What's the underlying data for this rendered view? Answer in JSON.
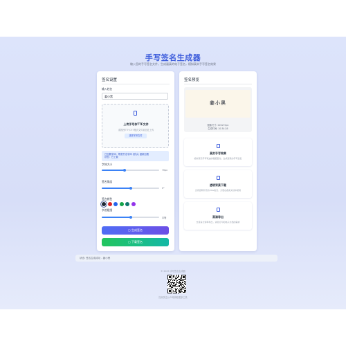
{
  "header": {
    "title": "手写签名生成器",
    "subtitle": "输入您的手写签名文件，生成逼真的电子签名，模拟真实手写签名效果"
  },
  "left_panel": {
    "title": "签名设置",
    "name_label": "输入姓名",
    "name_value": "姜小黑",
    "upload": {
      "title": "上传手写体TTF文件",
      "hint": "或拖拽TTF/OTF格式文件到此处上传",
      "button": "选择字体文件"
    },
    "info_lines": [
      "已加载字体：等宽书法字体 (默认) 重新加载",
      "状态：已上载"
    ],
    "font_size": {
      "label": "字体大小",
      "value": "70px",
      "level": 0.4
    },
    "slant": {
      "label": "签名角度",
      "value": "0°",
      "level": 0.5
    },
    "color": {
      "label": "签名颜色",
      "swatches": [
        "#1f2937",
        "#dc2626",
        "#2563eb",
        "#16a34a",
        "#0f766e",
        "#9333ea"
      ],
      "selected_index": 0
    },
    "thickness": {
      "label": "字迹粗细",
      "value": "中等",
      "level": 0.5
    },
    "generate_button": "生成签名",
    "download_button": "下载签名"
  },
  "right_panel": {
    "title": "签名预览",
    "signature": "姜小黑",
    "meta_size": "图像尺寸: 220x70px",
    "meta_time": "生成时间: 10:34:28",
    "features": [
      {
        "title": "真实手写效果",
        "desc": "模拟真实手写笔迹的粗细变化，生成逼真的手写签名"
      },
      {
        "title": "透明背景下载",
        "desc": "支持透明背景的PNG格式，方便在各类文档中使用"
      },
      {
        "title": "高清导出",
        "desc": "支持多分辨率导出，满足打印和电子文档的需求"
      }
    ]
  },
  "status_bar": "状态: 签名生成成功 - 姜小黑",
  "footer": {
    "copyright": "© 2025 手写签名生成器",
    "caption": "扫码关注公众号获取更多工具"
  }
}
